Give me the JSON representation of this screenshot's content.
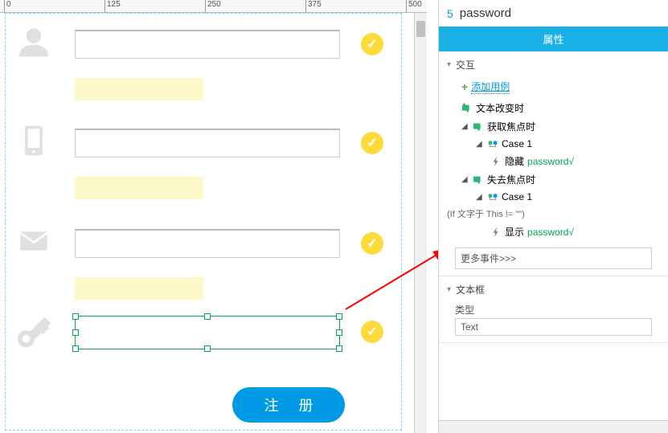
{
  "ruler": {
    "ticks": [
      "0",
      "125",
      "250",
      "375",
      "500"
    ]
  },
  "canvas": {
    "register_label": "注 册"
  },
  "panel": {
    "element_number": "5",
    "element_name": "password",
    "tab_label": "属性",
    "sections": {
      "interaction": "交互",
      "textbox": "文本框"
    },
    "add_case": "添加用例",
    "events": {
      "text_change": "文本改变时",
      "focus_gain": "获取焦点时",
      "focus_lose": "失去焦点时"
    },
    "case1_a": "Case 1",
    "case1_b": "Case 1",
    "action_hide": "隐藏",
    "action_show": "显示",
    "target_a": "password√",
    "target_b": "password√",
    "condition": "(If 文字于 This != \"\")",
    "more_events": "更多事件>>>",
    "type_label": "类型",
    "type_value": "Text"
  }
}
